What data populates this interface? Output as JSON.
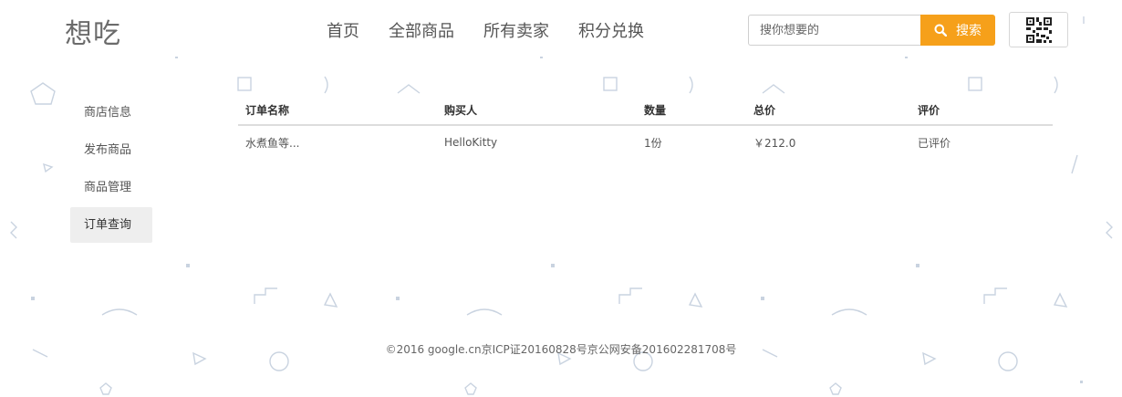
{
  "header": {
    "logo": "想吃",
    "nav": [
      "首页",
      "全部商品",
      "所有卖家",
      "积分兑换"
    ],
    "search": {
      "placeholder": "搜你想要的",
      "button_label": "搜索"
    },
    "qr_icon": "qrcode-icon"
  },
  "sidebar": {
    "items": [
      {
        "label": "商店信息",
        "active": false
      },
      {
        "label": "发布商品",
        "active": false
      },
      {
        "label": "商品管理",
        "active": false
      },
      {
        "label": "订单查询",
        "active": true
      }
    ]
  },
  "orders": {
    "columns": [
      "订单名称",
      "购买人",
      "数量",
      "总价",
      "评价"
    ],
    "rows": [
      {
        "name": "水煮鱼等...",
        "buyer": "HelloKitty",
        "quantity": "1份",
        "total": "￥212.0",
        "review": "已评价"
      }
    ]
  },
  "footer": {
    "copyright": "©2016 google.cn京ICP证20160828号京公网安备201602281708号"
  },
  "colors": {
    "accent": "#f6a01a",
    "decoration": "#c9d3e0",
    "sidebar_active_bg": "#eeeeee"
  }
}
